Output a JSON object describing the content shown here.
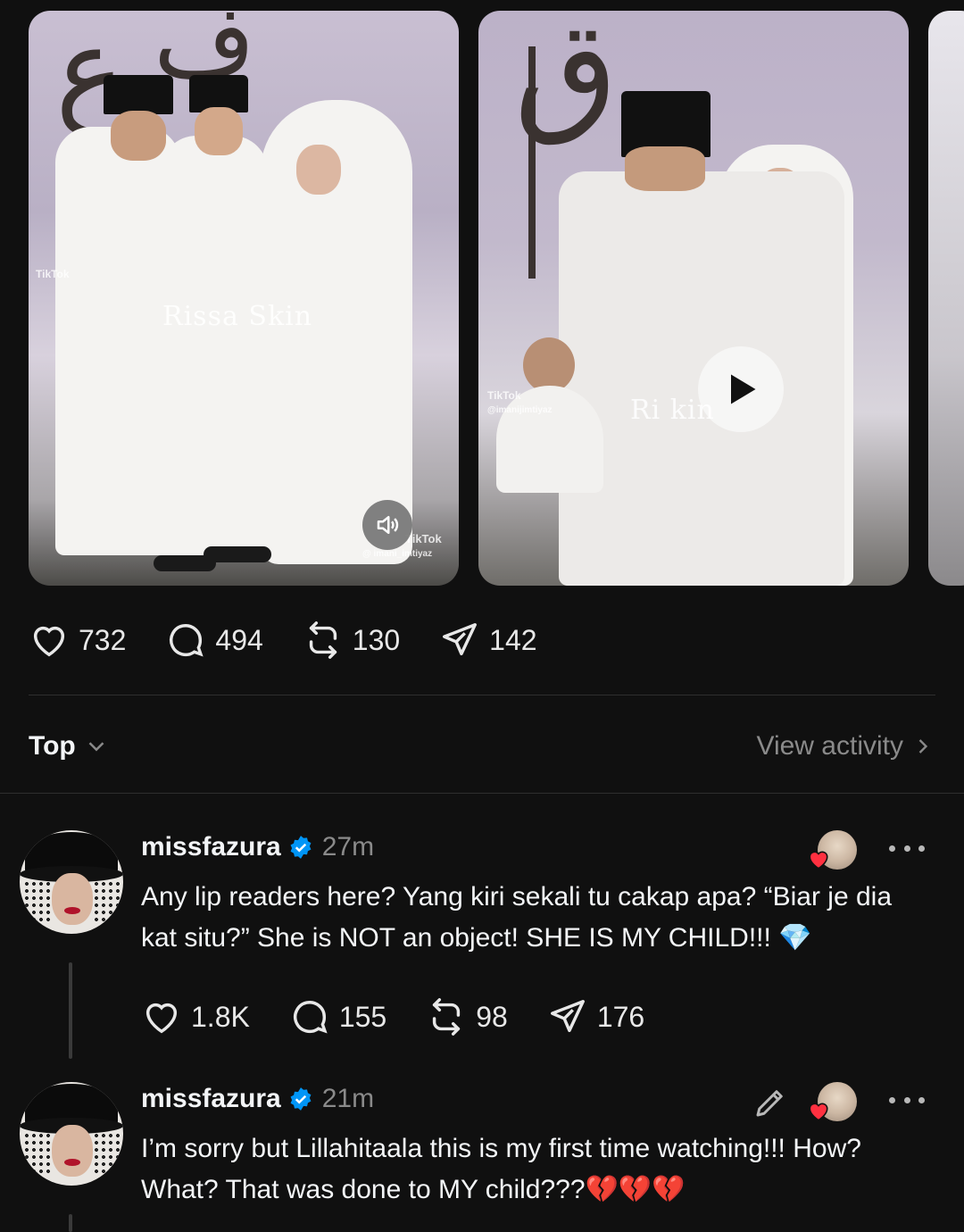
{
  "media": {
    "item1_watermark": "TikTok",
    "item1_overlay_text": "Rissa Skin",
    "item1_handle": "@ imani_imtiyaz",
    "item1_brand": "TikTok",
    "item2_watermark": "TikTok",
    "item2_handle": "@imanijimtiyaz",
    "item2_overlay_text": "Ri          kin"
  },
  "main_post": {
    "likes": "732",
    "replies": "494",
    "reposts": "130",
    "shares": "142"
  },
  "sort": {
    "label": "Top",
    "view_activity": "View activity"
  },
  "replies": [
    {
      "username": "missfazura",
      "time": "27m",
      "text": "Any lip readers here? Yang kiri sekali tu cakap apa? “Biar je dia kat situ?” She is NOT an object! SHE IS MY CHILD!!! 💎",
      "likes": "1.8K",
      "replies": "155",
      "reposts": "98",
      "shares": "176"
    },
    {
      "username": "missfazura",
      "time": "21m",
      "text": "I’m sorry but Lillahitaala this is my first time watching!!! How? What? That was done to MY child???💔💔💔"
    }
  ],
  "icons": {
    "like": "heart-icon",
    "reply": "comment-icon",
    "repost": "repost-icon",
    "share": "send-icon",
    "verified": "verified-badge-icon",
    "more": "more-icon",
    "edit": "pencil-icon",
    "play": "play-icon",
    "mute": "speaker-icon"
  },
  "colors": {
    "background": "#101010",
    "verified": "#0095f6",
    "heart": "#ff3040",
    "muted_text": "#8a8a8a"
  }
}
